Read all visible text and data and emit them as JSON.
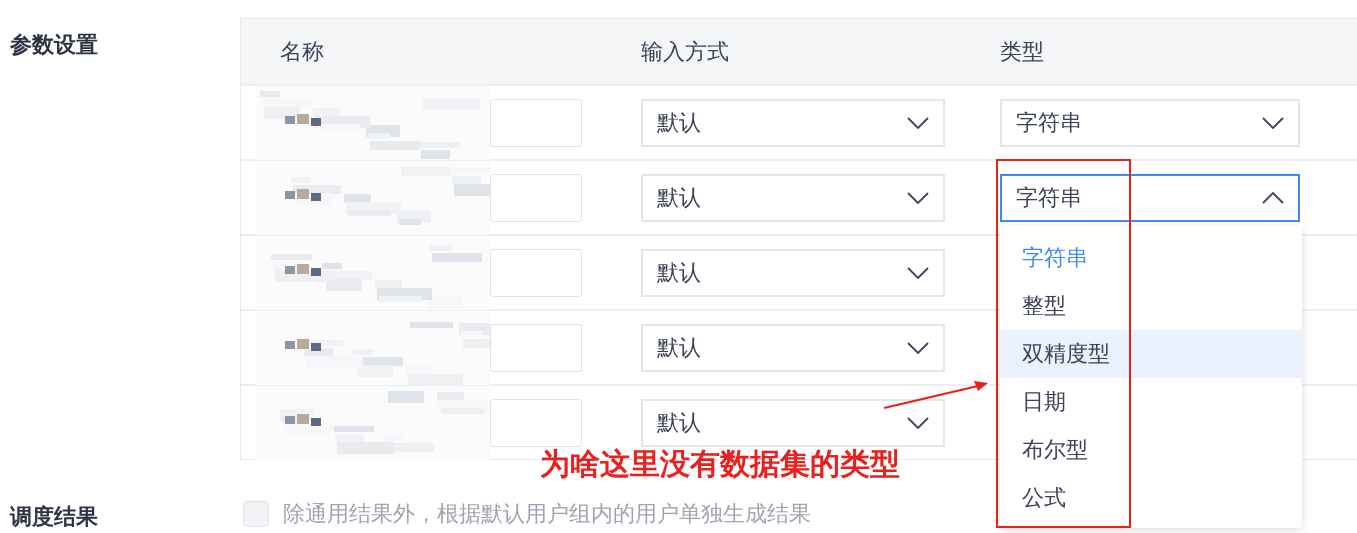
{
  "sections": [
    {
      "label": "参数设置"
    },
    {
      "label": "调度结果"
    }
  ],
  "table": {
    "columns": [
      "名称",
      "输入方式",
      "类型"
    ],
    "rows": [
      {
        "input_method": "默认",
        "type": {
          "value": "字符串",
          "open": false
        }
      },
      {
        "input_method": "默认",
        "type": {
          "value": "字符串",
          "open": true
        }
      },
      {
        "input_method": "默认"
      },
      {
        "input_method": "默认"
      },
      {
        "input_method": "默认"
      }
    ]
  },
  "type_dropdown": {
    "options": [
      {
        "label": "字符串",
        "selected": true,
        "hovered": false
      },
      {
        "label": "整型",
        "selected": false,
        "hovered": false
      },
      {
        "label": "双精度型",
        "selected": false,
        "hovered": true
      },
      {
        "label": "日期",
        "selected": false,
        "hovered": false
      },
      {
        "label": "布尔型",
        "selected": false,
        "hovered": false
      },
      {
        "label": "公式",
        "selected": false,
        "hovered": false
      }
    ]
  },
  "schedule_option": {
    "label": "除通用结果外，根据默认用户组内的用户单独生成结果",
    "checked": false,
    "disabled": true
  },
  "annotation": {
    "text": "为啥这里没有数据集的类型"
  }
}
